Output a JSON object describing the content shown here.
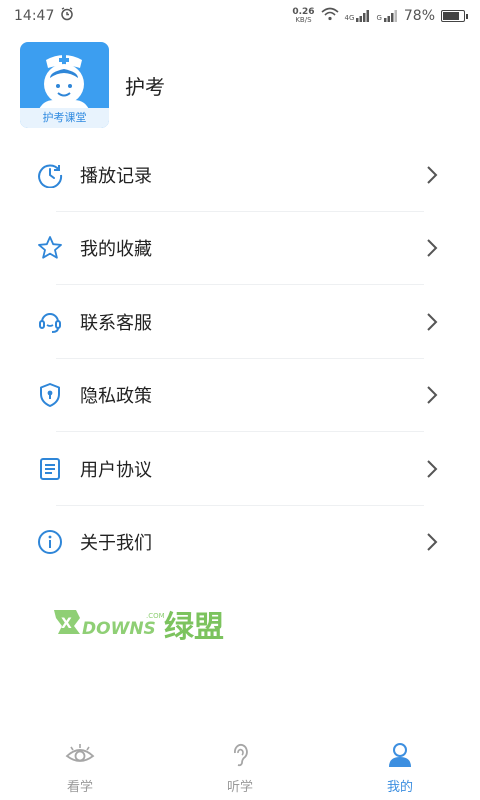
{
  "status_bar": {
    "time": "14:47",
    "net_speed": "0.26",
    "net_unit": "KB/S",
    "network_1": "4G",
    "network_2": "G",
    "battery": "78%",
    "battery_level": 0.78
  },
  "header": {
    "logo_caption": "护考课堂",
    "app_name": "护考"
  },
  "menu": {
    "items": [
      {
        "label": "播放记录",
        "icon": "clock-icon"
      },
      {
        "label": "我的收藏",
        "icon": "star-icon"
      },
      {
        "label": "联系客服",
        "icon": "headset-icon"
      },
      {
        "label": "隐私政策",
        "icon": "shield-icon"
      },
      {
        "label": "用户协议",
        "icon": "document-icon"
      },
      {
        "label": "关于我们",
        "icon": "info-icon"
      }
    ]
  },
  "watermark": {
    "brand": "DOWNS",
    "brand_prefix": "X",
    "suffix": ".COM",
    "cn": "绿盟"
  },
  "tabbar": {
    "tabs": [
      {
        "label": "看学",
        "icon": "eye-icon",
        "active": false
      },
      {
        "label": "听学",
        "icon": "ear-icon",
        "active": false
      },
      {
        "label": "我的",
        "icon": "user-icon",
        "active": true
      }
    ]
  },
  "colors": {
    "accent": "#3d8fe0",
    "icon_blue": "#2f86d8",
    "logo_bg": "#3c9ef0"
  }
}
